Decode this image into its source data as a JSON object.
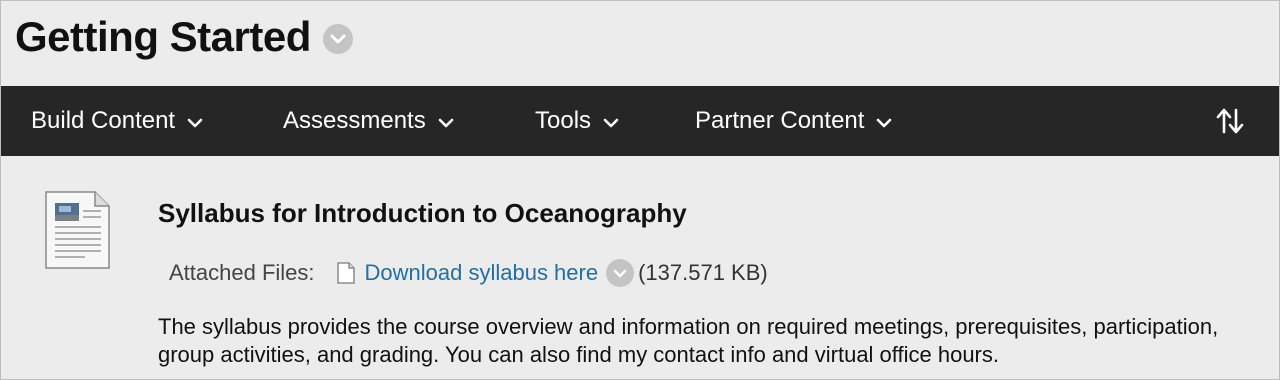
{
  "page": {
    "title": "Getting Started"
  },
  "toolbar": {
    "menus": [
      {
        "label": "Build Content"
      },
      {
        "label": "Assessments"
      },
      {
        "label": "Tools"
      },
      {
        "label": "Partner Content"
      }
    ],
    "reorder_icon": "up-down-arrows-icon"
  },
  "content_item": {
    "icon": "document-icon",
    "title": "Syllabus for Introduction to Oceanography",
    "attached_files_label": "Attached Files:",
    "file": {
      "icon": "file-icon",
      "name": "Download syllabus here",
      "size": "(137.571 KB)"
    },
    "description": "The syllabus provides the course overview and information on required meetings, prerequisites, participation, group activities, and grading. You can also find my contact info and virtual office hours."
  },
  "colors": {
    "toolbar_bg": "#262626",
    "page_bg": "#ececec",
    "link": "#1f6fa8"
  }
}
